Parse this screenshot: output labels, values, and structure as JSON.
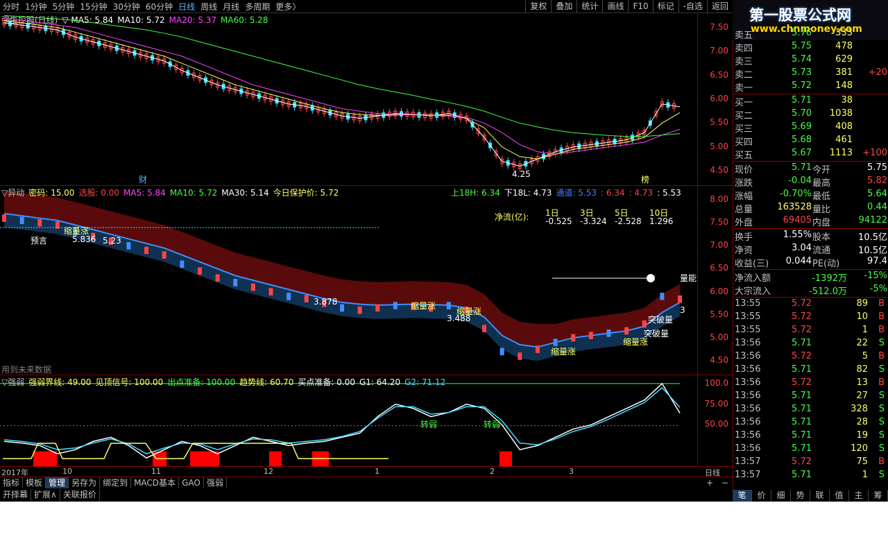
{
  "toolbar": {
    "timeframes": [
      "分时",
      "1分钟",
      "5分钟",
      "15分钟",
      "30分钟",
      "60分钟",
      "日线",
      "周线",
      "月线",
      "多周期",
      "更多〉"
    ],
    "active": "日线",
    "tools": [
      "复权",
      "叠加",
      "统计",
      "画线",
      "F10",
      "标记",
      "-自选",
      "返回"
    ]
  },
  "logo": {
    "title": "第一股票公式网",
    "url": "www.chnmoney.com"
  },
  "panel1": {
    "legend": [
      {
        "text": "强生控股(日线)",
        "color": "#c0c0c0"
      },
      {
        "text": "▽ MA5: 5.84",
        "color": "#ffffff"
      },
      {
        "text": "MA10: 5.72",
        "color": "#ffffff"
      },
      {
        "text": "MA20: 5.37",
        "color": "#ff44ff"
      },
      {
        "text": "MA60: 5.28",
        "color": "#44ff44"
      }
    ],
    "yaxis": [
      "7.50",
      "7.00",
      "6.50",
      "6.00",
      "5.50",
      "5.00",
      "4.50"
    ],
    "low_label": "4.25",
    "marks": [
      "财",
      "榜"
    ]
  },
  "panel2": {
    "legend": [
      {
        "text": "▽异动",
        "color": "#c0c0c0"
      },
      {
        "text": "密码: 15.00",
        "color": "#ffff66"
      },
      {
        "text": "选股: 0.00",
        "color": "#ff4444"
      },
      {
        "text": "MA5: 5.84",
        "color": "#ff44ff"
      },
      {
        "text": "MA10: 5.72",
        "color": "#44ff44"
      },
      {
        "text": "MA30: 5.14",
        "color": "#ffffff"
      },
      {
        "text": "今日保护价: 5.72",
        "color": "#ffff66"
      }
    ],
    "legend_right": [
      {
        "text": "上18H: 6.34",
        "color": "#44ff44"
      },
      {
        "text": "下18L: 4.73",
        "color": "#ffffff"
      },
      {
        "text": "通道: 5.53",
        "color": "#3f7fff"
      },
      {
        "text": ": 6.34",
        "color": "#ff4444"
      },
      {
        "text": ": 4.73",
        "color": "#ff4444"
      },
      {
        "text": ": 5.53",
        "color": "#ffffff"
      }
    ],
    "netflow_title": "净流(亿):",
    "netflow_headers": [
      "1日",
      "3日",
      "5日",
      "10日"
    ],
    "netflow_values": [
      "-0.525",
      "-3.324",
      "-2.528",
      "1.296"
    ],
    "yaxis": [
      "8.00",
      "7.50",
      "7.00",
      "6.50",
      "6.00",
      "5.50",
      "5.00",
      "4.50"
    ],
    "annotations": [
      "缩量涨",
      "缩量涨",
      "缩量涨",
      "缩量涨",
      "缩量涨",
      "突破量",
      "突破量",
      "量能",
      "用到未来数据",
      "预言",
      "5.836",
      "3.878",
      "3.488",
      "5.23",
      "3"
    ],
    "future_note": "用到未来数据"
  },
  "panel3": {
    "legend": [
      {
        "text": "▽强弱",
        "color": "#c0c0c0"
      },
      {
        "text": "强弱界线: 49.00",
        "color": "#ffff66"
      },
      {
        "text": "见顶信号: 100.00",
        "color": "#ffff66"
      },
      {
        "text": "出点准备: 100.00",
        "color": "#44ff44"
      },
      {
        "text": "趋势线: 60.70",
        "color": "#ffff66"
      },
      {
        "text": "买点准备: 0.00",
        "color": "#ffffff"
      },
      {
        "text": "G1: 64.20",
        "color": "#ffffff"
      },
      {
        "text": "G2: 71.12",
        "color": "#44ddff"
      }
    ],
    "yaxis": [
      "100.0",
      "75.00",
      "50.00"
    ],
    "labels": [
      "转弱",
      "转弱"
    ]
  },
  "xaxis": {
    "labels": [
      "2017年",
      "10",
      "11",
      "12",
      "1",
      "2",
      "3"
    ],
    "right": "日线"
  },
  "bottom_tabs": [
    "指标",
    "模板",
    "管理",
    "另存为",
    "绑定到",
    "MACD基本",
    "GAO",
    "强弱"
  ],
  "bottom_tabs_active": "管理",
  "bottom_tabs2": [
    "开择幕",
    "扩展∧",
    "关联报价"
  ],
  "orderbook": {
    "sell": [
      {
        "label": "卖五",
        "price": "5.76",
        "vol": "333",
        "delta": ""
      },
      {
        "label": "卖四",
        "price": "5.75",
        "vol": "478",
        "delta": ""
      },
      {
        "label": "卖三",
        "price": "5.74",
        "vol": "629",
        "delta": ""
      },
      {
        "label": "卖二",
        "price": "5.73",
        "vol": "381",
        "delta": "+20"
      },
      {
        "label": "卖一",
        "price": "5.72",
        "vol": "148",
        "delta": ""
      }
    ],
    "buy": [
      {
        "label": "买一",
        "price": "5.71",
        "vol": "38",
        "delta": ""
      },
      {
        "label": "买二",
        "price": "5.70",
        "vol": "1038",
        "delta": ""
      },
      {
        "label": "买三",
        "price": "5.69",
        "vol": "408",
        "delta": ""
      },
      {
        "label": "买四",
        "price": "5.68",
        "vol": "461",
        "delta": ""
      },
      {
        "label": "买五",
        "price": "5.67",
        "vol": "1113",
        "delta": "+100"
      }
    ]
  },
  "stats": [
    {
      "l1": "现价",
      "v1": "5.71",
      "c1": "#44ff44",
      "l2": "今开",
      "v2": "5.75",
      "c2": "#ffffff"
    },
    {
      "l1": "涨跌",
      "v1": "-0.04",
      "c1": "#44ff44",
      "l2": "最高",
      "v2": "5.82",
      "c2": "#ff4444"
    },
    {
      "l1": "涨幅",
      "v1": "-0.70%",
      "c1": "#44ff44",
      "l2": "最低",
      "v2": "5.64",
      "c2": "#44ff44"
    },
    {
      "l1": "总量",
      "v1": "163528",
      "c1": "#ffff66",
      "l2": "量比",
      "v2": "0.44",
      "c2": "#44ff44"
    },
    {
      "l1": "外盘",
      "v1": "69405",
      "c1": "#ff4444",
      "l2": "内盘",
      "v2": "94122",
      "c2": "#44ff44"
    }
  ],
  "stats2": [
    {
      "l1": "换手",
      "v1": "1.55%",
      "c1": "#ffffff",
      "l2": "股本",
      "v2": "10.5亿",
      "c2": "#ffffff"
    },
    {
      "l1": "净资",
      "v1": "3.04",
      "c1": "#ffffff",
      "l2": "流通",
      "v2": "10.5亿",
      "c2": "#ffffff"
    },
    {
      "l1": "收益(三)",
      "v1": "0.044",
      "c1": "#ffffff",
      "l2": "PE(动)",
      "v2": "97.4",
      "c2": "#ffffff"
    }
  ],
  "flow": [
    {
      "label": "净流入额",
      "value": "-1392万",
      "pct": "-15%"
    },
    {
      "label": "大宗流入",
      "value": "-512.0万",
      "pct": "-5%"
    }
  ],
  "ticks": [
    {
      "t": "13:55",
      "p": "5.72",
      "v": "89",
      "s": "B"
    },
    {
      "t": "13:55",
      "p": "5.72",
      "v": "10",
      "s": "B"
    },
    {
      "t": "13:55",
      "p": "5.72",
      "v": "1",
      "s": "B"
    },
    {
      "t": "13:56",
      "p": "5.71",
      "v": "22",
      "s": "S"
    },
    {
      "t": "13:56",
      "p": "5.72",
      "v": "5",
      "s": "B"
    },
    {
      "t": "13:56",
      "p": "5.71",
      "v": "82",
      "s": "S"
    },
    {
      "t": "13:56",
      "p": "5.72",
      "v": "13",
      "s": "B"
    },
    {
      "t": "13:56",
      "p": "5.71",
      "v": "27",
      "s": "S"
    },
    {
      "t": "13:56",
      "p": "5.71",
      "v": "328",
      "s": "S"
    },
    {
      "t": "13:56",
      "p": "5.71",
      "v": "28",
      "s": "S"
    },
    {
      "t": "13:56",
      "p": "5.71",
      "v": "19",
      "s": "S"
    },
    {
      "t": "13:56",
      "p": "5.71",
      "v": "120",
      "s": "S"
    },
    {
      "t": "13:57",
      "p": "5.72",
      "v": "75",
      "s": "B"
    },
    {
      "t": "13:57",
      "p": "5.71",
      "v": "1",
      "s": "S"
    }
  ],
  "side_tabs": [
    "笔",
    "价",
    "细",
    "势",
    "联",
    "值",
    "主",
    "筹"
  ],
  "side_tabs_active": "笔",
  "colors": {
    "up": "#ff4444",
    "down": "#44ff44",
    "channel_upper": "#5a0a0a",
    "channel_lower": "#0f3050",
    "blue": "#3f8fff"
  },
  "chart_data": [
    {
      "type": "line",
      "title": "强生控股(日线)",
      "ylim": [
        4.2,
        7.8
      ],
      "series": [
        {
          "name": "MA5",
          "values": [
            7.6,
            7.55,
            7.5,
            7.45,
            7.3,
            7.2,
            7.1,
            7.0,
            6.9,
            6.8,
            6.6,
            6.45,
            6.3,
            6.2,
            6.1,
            6.0,
            5.9,
            5.85,
            5.75,
            5.65,
            5.6,
            5.65,
            5.7,
            5.68,
            5.65,
            5.7,
            5.6,
            5.2,
            4.7,
            4.6,
            4.75,
            4.9,
            5.0,
            5.05,
            5.1,
            5.15,
            5.3,
            5.9,
            5.84
          ]
        },
        {
          "name": "MA10",
          "values": [
            7.65,
            7.6,
            7.55,
            7.5,
            7.4,
            7.3,
            7.2,
            7.1,
            7.0,
            6.9,
            6.75,
            6.6,
            6.45,
            6.3,
            6.2,
            6.1,
            6.0,
            5.9,
            5.8,
            5.72,
            5.68,
            5.66,
            5.67,
            5.68,
            5.67,
            5.66,
            5.6,
            5.4,
            5.0,
            4.8,
            4.75,
            4.85,
            4.95,
            5.0,
            5.05,
            5.1,
            5.2,
            5.5,
            5.72
          ]
        },
        {
          "name": "MA20",
          "values": [
            7.7,
            7.65,
            7.6,
            7.55,
            7.5,
            7.4,
            7.3,
            7.2,
            7.1,
            7.0,
            6.9,
            6.75,
            6.6,
            6.45,
            6.3,
            6.2,
            6.1,
            6.0,
            5.9,
            5.8,
            5.75,
            5.7,
            5.68,
            5.67,
            5.66,
            5.65,
            5.62,
            5.5,
            5.3,
            5.05,
            4.9,
            4.85,
            4.9,
            4.95,
            5.0,
            5.05,
            5.1,
            5.25,
            5.37
          ]
        },
        {
          "name": "MA60",
          "values": [
            7.75,
            7.73,
            7.7,
            7.68,
            7.65,
            7.6,
            7.55,
            7.5,
            7.45,
            7.38,
            7.3,
            7.2,
            7.1,
            7.0,
            6.9,
            6.8,
            6.7,
            6.6,
            6.5,
            6.4,
            6.3,
            6.22,
            6.15,
            6.08,
            6.0,
            5.93,
            5.85,
            5.75,
            5.62,
            5.5,
            5.42,
            5.35,
            5.3,
            5.27,
            5.24,
            5.22,
            5.22,
            5.25,
            5.28
          ]
        }
      ]
    },
    {
      "type": "line",
      "title": "强弱",
      "ylim": [
        0,
        110
      ],
      "series": [
        {
          "name": "G1",
          "values": [
            30,
            28,
            25,
            15,
            20,
            30,
            35,
            25,
            10,
            20,
            30,
            25,
            15,
            25,
            35,
            30,
            25,
            28,
            30,
            35,
            40,
            60,
            75,
            70,
            60,
            65,
            75,
            70,
            50,
            20,
            25,
            35,
            45,
            50,
            60,
            70,
            80,
            100,
            64.2
          ]
        },
        {
          "name": "G2",
          "values": [
            32,
            30,
            27,
            20,
            22,
            28,
            33,
            27,
            15,
            22,
            28,
            27,
            20,
            27,
            33,
            32,
            28,
            30,
            32,
            36,
            42,
            58,
            72,
            72,
            63,
            65,
            72,
            72,
            55,
            28,
            26,
            33,
            42,
            48,
            57,
            67,
            77,
            95,
            71.12
          ]
        }
      ]
    }
  ]
}
